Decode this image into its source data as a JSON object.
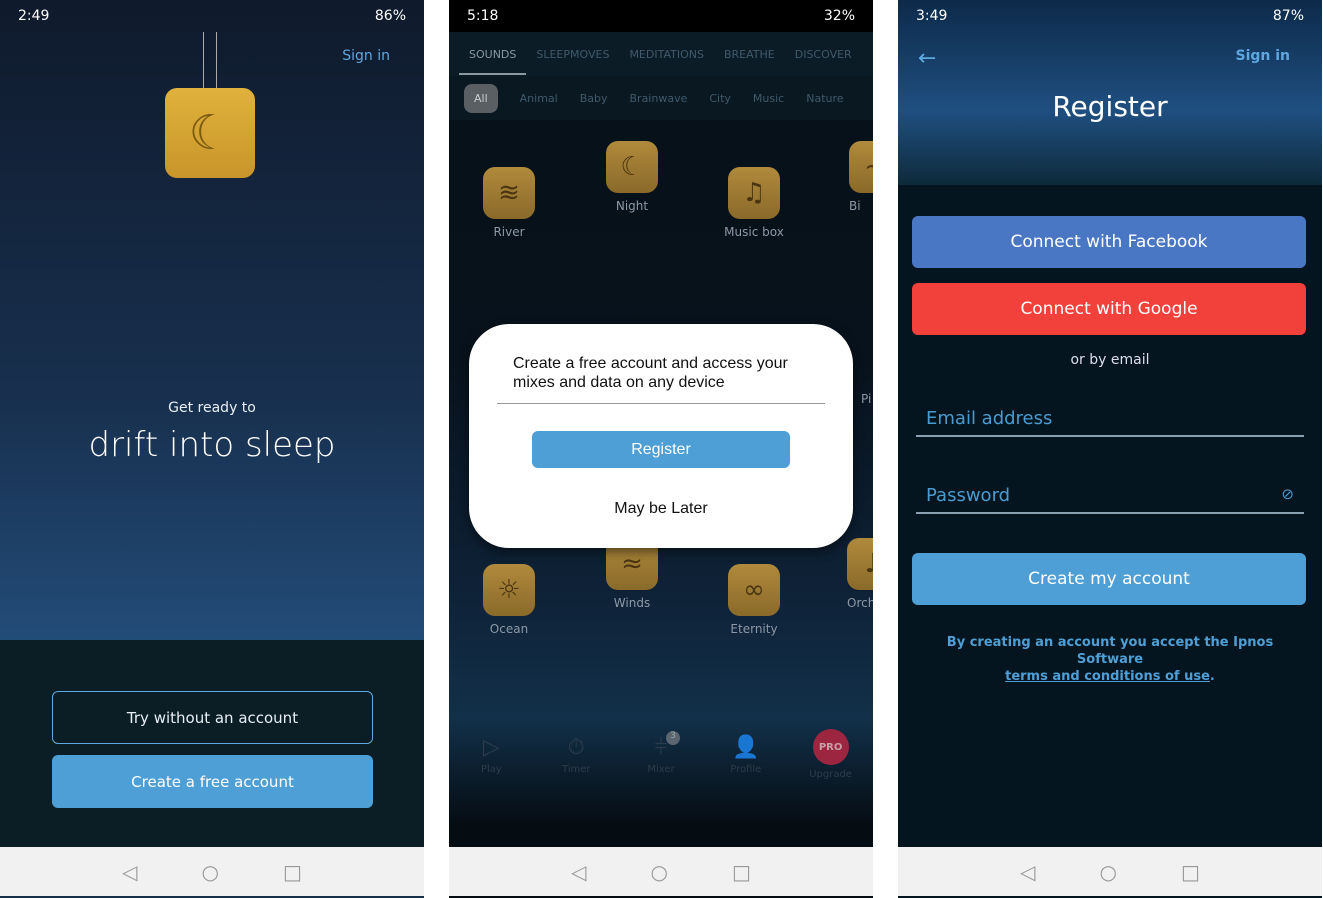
{
  "screen1": {
    "status": {
      "time": "2:49",
      "battery": "86%"
    },
    "sign_in": "Sign in",
    "tagline_small": "Get ready to",
    "tagline_large": "drift into sleep",
    "try_button": "Try without an account",
    "create_button": "Create a free account"
  },
  "screen2": {
    "status": {
      "time": "5:18",
      "battery": "32%"
    },
    "tabs": [
      "SOUNDS",
      "SLEEPMOVES",
      "MEDITATIONS",
      "BREATHE",
      "DISCOVER"
    ],
    "chips": [
      "All",
      "Animal",
      "Baby",
      "Brainwave",
      "City",
      "Music",
      "Nature"
    ],
    "sounds": [
      "River",
      "Night",
      "Music box",
      "Bi",
      "Pi",
      "Ocean",
      "Winds",
      "Eternity",
      "Orch"
    ],
    "dialog": {
      "message": "Create a free account and access your mixes and data on any device",
      "register": "Register",
      "later": "May be Later"
    },
    "bottom_nav": [
      "Play",
      "Timer",
      "Mixer",
      "Profile",
      "Upgrade"
    ],
    "mixer_badge": "3",
    "pro_badge": "PRO"
  },
  "screen3": {
    "status": {
      "time": "3:49",
      "battery": "87%"
    },
    "sign_in": "Sign in",
    "title": "Register",
    "facebook": "Connect with Facebook",
    "google": "Connect with Google",
    "or_email": "or by email",
    "email_placeholder": "Email address",
    "password_placeholder": "Password",
    "create": "Create my account",
    "terms_prefix": "By creating an account you accept the Ipnos Software",
    "terms_link": "terms and conditions of use",
    "terms_suffix": ".",
    "colors": {
      "facebook": "#4a77c4",
      "google": "#f2403a",
      "primary": "#4ea0d6"
    }
  }
}
